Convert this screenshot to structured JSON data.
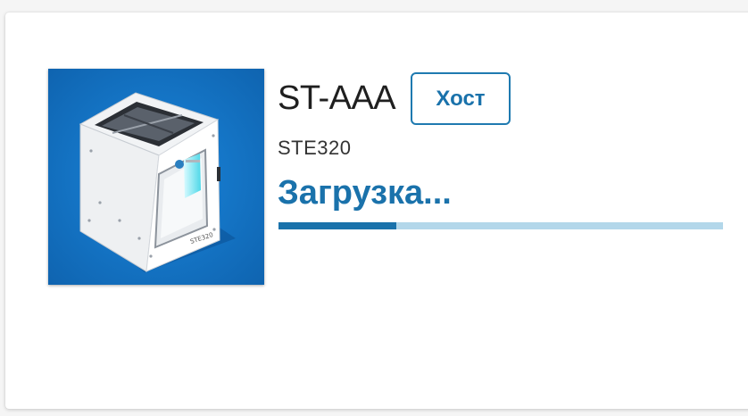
{
  "printer": {
    "name": "ST-AAA",
    "role_label": "Хост",
    "model": "STE320",
    "status_text": "Загрузка...",
    "progress": 0.265
  },
  "image": {
    "description_icon": "3d-printer-image",
    "plate_text": "STE320"
  },
  "colors": {
    "accent": "#1a72ab",
    "progress_track": "#b3d7ea",
    "image_background": "#1474c8"
  }
}
